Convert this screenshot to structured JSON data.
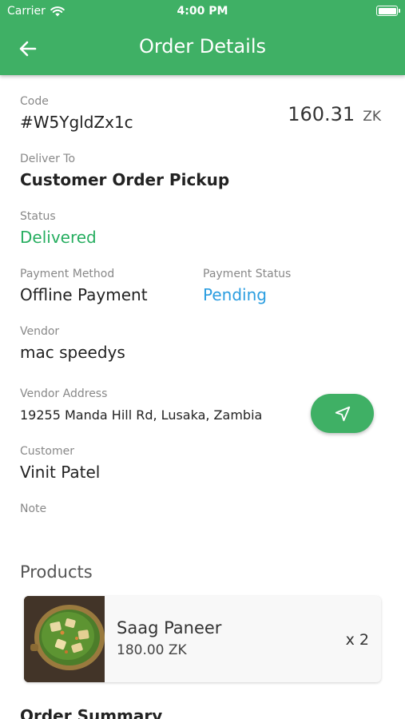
{
  "status_bar": {
    "carrier": "Carrier",
    "time": "4:00 PM"
  },
  "header": {
    "title": "Order Details"
  },
  "order": {
    "code_label": "Code",
    "code": "#W5YgldZx1c",
    "amount": "160.31",
    "currency": "ZK",
    "deliver_to_label": "Deliver To",
    "deliver_to": "Customer Order Pickup",
    "status_label": "Status",
    "status": "Delivered",
    "payment_method_label": "Payment Method",
    "payment_method": "Offline Payment",
    "payment_status_label": "Payment Status",
    "payment_status": "Pending",
    "vendor_label": "Vendor",
    "vendor": "mac speedys",
    "vendor_address_label": "Vendor Address",
    "vendor_address": "19255 Manda Hill Rd, Lusaka, Zambia",
    "customer_label": "Customer",
    "customer": "Vinit Patel",
    "note_label": "Note",
    "note": ""
  },
  "products": {
    "title": "Products",
    "items": [
      {
        "name": "Saag Paneer",
        "price": "180.00 ZK",
        "qty": "x 2"
      }
    ]
  },
  "summary": {
    "title": "Order Summary"
  },
  "colors": {
    "primary": "#3fb065",
    "status_green": "#27ae60",
    "link_blue": "#2a9de0"
  },
  "icons": {
    "back": "arrow-left-icon",
    "navigate": "navigation-arrow-icon",
    "wifi": "wifi-icon",
    "battery": "battery-icon"
  }
}
